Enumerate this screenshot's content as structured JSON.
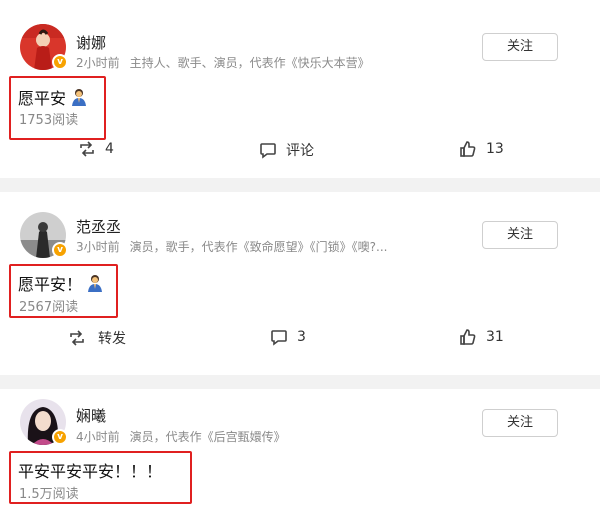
{
  "follow_label": "关注",
  "colors": {
    "highlight": "#e02020",
    "badge": "#f7a200",
    "meta": "#8a8a8a"
  },
  "posts": [
    {
      "author": "谢娜",
      "time": "2小时前",
      "bio": "主持人、歌手、演员，代表作《快乐大本营》",
      "text": "愿平安",
      "emoji": "praying-person-emoji",
      "reads": "1753阅读",
      "repost": "4",
      "comment": "评论",
      "like": "13"
    },
    {
      "author": "范丞丞",
      "time": "3小时前",
      "bio": "演员，歌手，代表作《致命愿望》《门锁》《噢?...",
      "text": "愿平安！",
      "emoji": "praying-person-emoji",
      "reads": "2567阅读",
      "repost": "转发",
      "comment": "3",
      "like": "31"
    },
    {
      "author": "娴曦",
      "time": "4小时前",
      "bio": "演员，代表作《后宫甄嬛传》",
      "text": "平安平安平安！！！",
      "reads": "1.5万阅读"
    }
  ]
}
